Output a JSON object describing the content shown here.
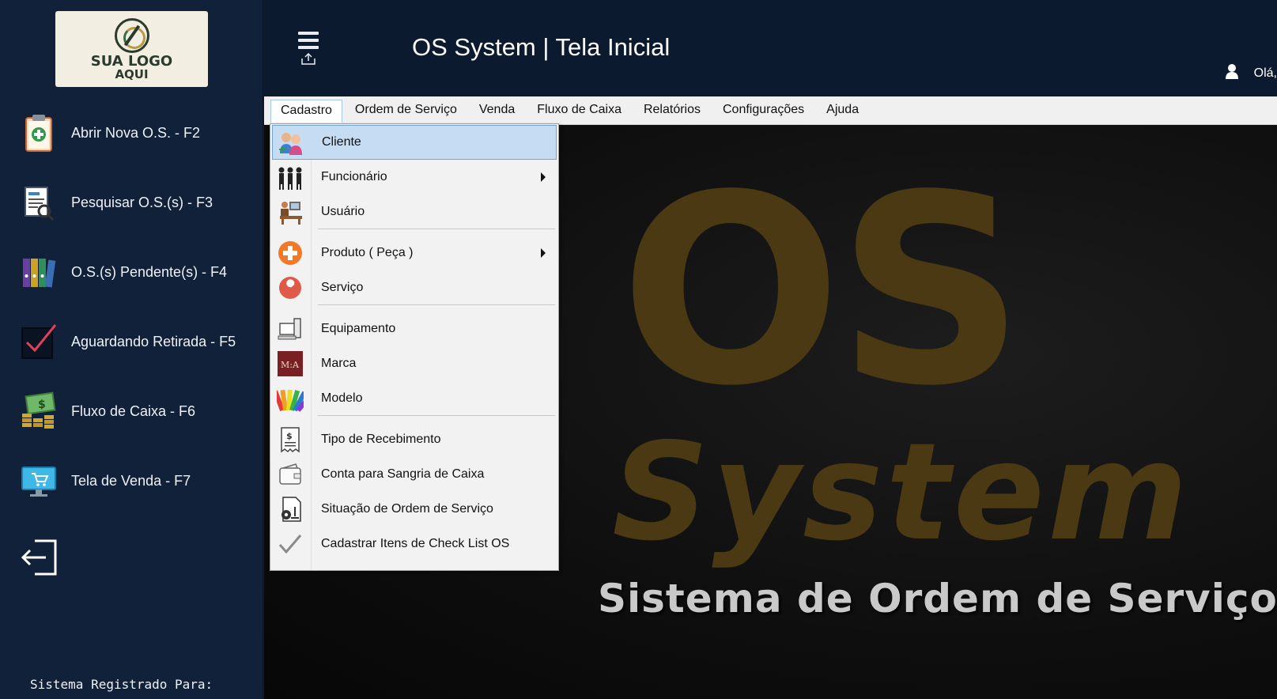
{
  "logo": {
    "line1": "SUA LOGO",
    "line2": "AQUI"
  },
  "sidebar": {
    "items": [
      {
        "label": "Abrir Nova O.S. - F2",
        "icon": "clipboard-add-icon"
      },
      {
        "label": "Pesquisar O.S.(s) - F3",
        "icon": "document-search-icon"
      },
      {
        "label": "O.S.(s)  Pendente(s) - F4",
        "icon": "binders-icon"
      },
      {
        "label": "Aguardando Retirada - F5",
        "icon": "checkbox-icon"
      },
      {
        "label": "Fluxo de Caixa - F6",
        "icon": "money-icon"
      },
      {
        "label": "Tela de Venda - F7",
        "icon": "monitor-cart-icon"
      }
    ],
    "logout_icon": "logout-icon",
    "registered": "Sistema Registrado Para:"
  },
  "header": {
    "title": "OS System | Tela Inicial",
    "greeting": "Olá,"
  },
  "menubar": {
    "items": [
      "Cadastro",
      "Ordem de Serviço",
      "Venda",
      "Fluxo de Caixa",
      "Relatórios",
      "Configurações",
      "Ajuda"
    ],
    "active": "Cadastro"
  },
  "dropdown": {
    "items": [
      {
        "label": "Cliente",
        "icon": "clients-icon",
        "submenu": false,
        "highlighted": true
      },
      {
        "label": "Funcionário",
        "icon": "employees-icon",
        "submenu": true
      },
      {
        "label": "Usuário",
        "icon": "user-desk-icon",
        "submenu": false
      },
      {
        "label": "Produto ( Peça )",
        "icon": "plus-circle-icon",
        "submenu": true
      },
      {
        "label": "Serviço",
        "icon": "wrench-icon",
        "submenu": false
      },
      {
        "label": "Equipamento",
        "icon": "computer-icon",
        "submenu": false
      },
      {
        "label": "Marca",
        "icon": "brand-icon",
        "submenu": false
      },
      {
        "label": "Modelo",
        "icon": "color-swatch-icon",
        "submenu": false
      },
      {
        "label": "Tipo de Recebimento",
        "icon": "receipt-icon",
        "submenu": false
      },
      {
        "label": "Conta para Sangria de Caixa",
        "icon": "wallet-icon",
        "submenu": false
      },
      {
        "label": "Situação de Ordem de Serviço",
        "icon": "settings-document-icon",
        "submenu": false
      },
      {
        "label": "Cadastrar Itens de Check List OS",
        "icon": "checkmark-icon",
        "submenu": false
      }
    ]
  },
  "background": {
    "big_text_1": "OS",
    "big_text_2": "System",
    "subtitle": "Sistema de Ordem de Serviço"
  },
  "colors": {
    "sidebar_bg": "#11213a",
    "header_bg": "#0c1a30",
    "accent_gold": "#a57f22",
    "menu_highlight": "#c5dcf3"
  }
}
